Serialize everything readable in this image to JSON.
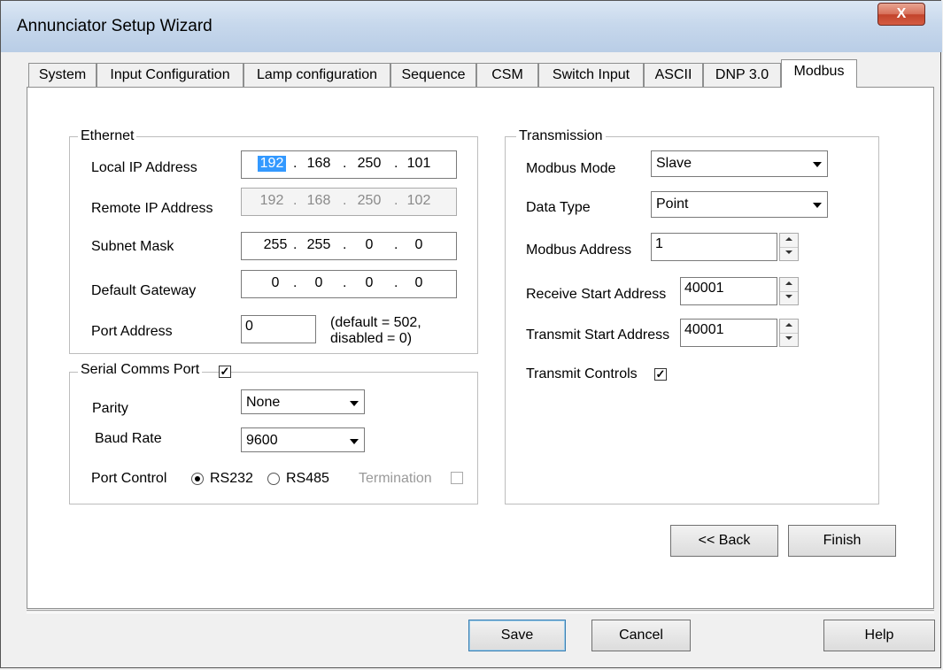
{
  "window": {
    "title": "Annunciator Setup Wizard",
    "close_glyph": "X"
  },
  "tabs": [
    {
      "label": "System"
    },
    {
      "label": "Input Configuration"
    },
    {
      "label": "Lamp configuration"
    },
    {
      "label": "Sequence"
    },
    {
      "label": "CSM"
    },
    {
      "label": "Switch Input"
    },
    {
      "label": "ASCII"
    },
    {
      "label": "DNP 3.0"
    },
    {
      "label": "Modbus"
    }
  ],
  "ethernet": {
    "group_label": "Ethernet",
    "local_ip": {
      "label": "Local IP Address",
      "octets": [
        "192",
        "168",
        "250",
        "101"
      ]
    },
    "remote_ip": {
      "label": "Remote IP Address",
      "octets": [
        "192",
        "168",
        "250",
        "102"
      ]
    },
    "subnet": {
      "label": "Subnet Mask",
      "octets": [
        "255",
        "255",
        "0",
        "0"
      ]
    },
    "gateway": {
      "label": "Default Gateway",
      "octets": [
        "0",
        "0",
        "0",
        "0"
      ]
    },
    "port": {
      "label": "Port Address",
      "value": "0",
      "note_line1": "(default = 502,",
      "note_line2": "disabled = 0)"
    },
    "dot": "."
  },
  "serial": {
    "group_label": "Serial Comms Port",
    "enabled_check": "✓",
    "parity": {
      "label": "Parity",
      "value": "None"
    },
    "baud": {
      "label": "Baud Rate",
      "value": "9600"
    },
    "port_control": {
      "label": "Port Control",
      "rs232": "RS232",
      "rs485": "RS485",
      "termination": "Termination"
    }
  },
  "transmission": {
    "group_label": "Transmission",
    "mode": {
      "label": "Modbus Mode",
      "value": "Slave"
    },
    "data_type": {
      "label": "Data Type",
      "value": "Point"
    },
    "address": {
      "label": "Modbus Address",
      "value": "1"
    },
    "rx_start": {
      "label": "Receive Start Address",
      "value": "40001"
    },
    "tx_start": {
      "label": "Transmit Start Address",
      "value": "40001"
    },
    "controls": {
      "label": "Transmit Controls",
      "check": "✓"
    }
  },
  "nav_buttons": {
    "back": "<< Back",
    "finish": "Finish"
  },
  "footer_buttons": {
    "save": "Save",
    "cancel": "Cancel",
    "help": "Help"
  }
}
